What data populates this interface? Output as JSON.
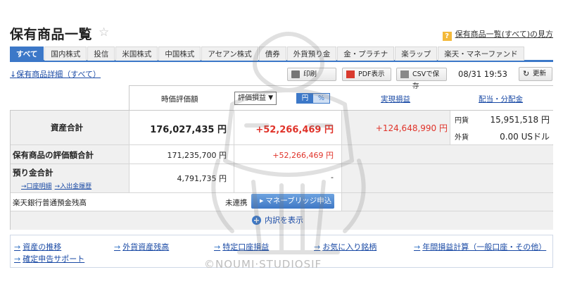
{
  "header": {
    "title": "保有商品一覧",
    "help_link": "保有商品一覧(すべて)の見方",
    "help_icon": "?"
  },
  "tabs": [
    {
      "label": "すべて",
      "active": true
    },
    {
      "label": "国内株式"
    },
    {
      "label": "投信"
    },
    {
      "label": "米国株式"
    },
    {
      "label": "中国株式"
    },
    {
      "label": "アセアン株式"
    },
    {
      "label": "債券"
    },
    {
      "label": "外貨預り金"
    },
    {
      "label": "金・プラチナ"
    },
    {
      "label": "楽ラップ"
    },
    {
      "label": "楽天・マネーファンド"
    }
  ],
  "toolbar": {
    "detail_link": "保有商品詳細（すべて）",
    "print": "印刷",
    "pdf": "PDF表示",
    "csv": "CSVで保存",
    "datetime": "08/31 19:53",
    "refresh": "更新"
  },
  "columns": {
    "market_value": "時価評価額",
    "pl_select": "評価損益",
    "toggle_yen": "円",
    "toggle_pct": "%",
    "realized": "実現損益",
    "dividends": "配当・分配金"
  },
  "rows": {
    "total": {
      "label": "資産合計",
      "value": "176,027,435 円",
      "pl": "+52,266,469 円",
      "realized": "+124,648,990 円"
    },
    "holdings": {
      "label": "保有商品の評価額合計",
      "value": "171,235,700 円",
      "pl": "+52,266,469 円"
    },
    "deposit": {
      "label": "預り金合計",
      "value": "4,791,735 円",
      "pl": "-",
      "sub_link1": "→口座明細",
      "sub_link2": "→入出金履歴"
    },
    "bank": {
      "label": "楽天銀行普通預金残高",
      "status": "未連携",
      "button": "マネーブリッジ申込"
    }
  },
  "dividends": {
    "yen_label": "円貨",
    "yen_value": "15,951,518 円",
    "fx_label": "外貨",
    "fx_value": "0.00 USドル"
  },
  "expand_label": "内訳を表示",
  "bottom_links": [
    "資産の推移",
    "外貨資産残高",
    "特定口座損益",
    "お気に入り銘柄",
    "年間損益計算（一般口座・その他）",
    "確定申告サポート"
  ],
  "watermark": "©NOUMI·STUDIOSIF",
  "colors": {
    "accent": "#3c78c8",
    "profit": "#e0332a",
    "link": "#1a4aa5"
  }
}
